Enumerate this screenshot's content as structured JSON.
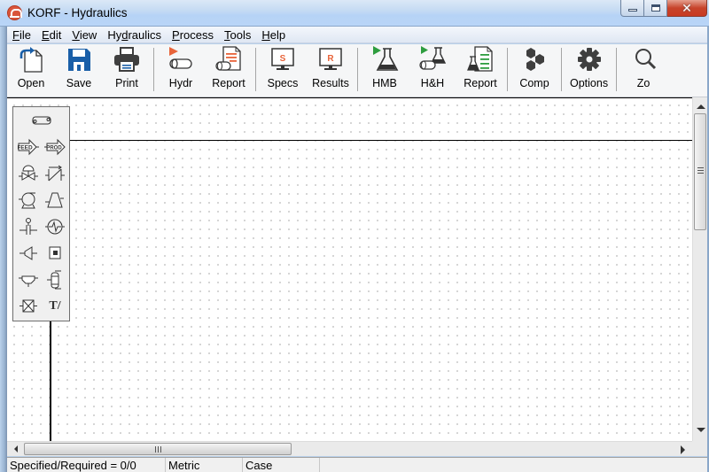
{
  "window": {
    "title": "KORF - Hydraulics",
    "controls": {
      "minimize": "minimize",
      "maximize": "maximize",
      "close": "✕"
    }
  },
  "menu": [
    {
      "label": "File",
      "mnemonic": "F"
    },
    {
      "label": "Edit",
      "mnemonic": "E"
    },
    {
      "label": "View",
      "mnemonic": "V"
    },
    {
      "label": "Hydraulics",
      "mnemonic": "d"
    },
    {
      "label": "Process",
      "mnemonic": "P"
    },
    {
      "label": "Tools",
      "mnemonic": "T"
    },
    {
      "label": "Help",
      "mnemonic": "H"
    }
  ],
  "toolbar": {
    "buttons": [
      {
        "label": "Open",
        "icon": "open-file-icon"
      },
      {
        "label": "Save",
        "icon": "save-disk-icon"
      },
      {
        "label": "Print",
        "icon": "printer-icon"
      },
      {
        "label": "Hydr",
        "icon": "run-hydraulics-icon"
      },
      {
        "label": "Report",
        "icon": "hydraulics-report-icon"
      },
      {
        "label": "Specs",
        "icon": "specs-monitor-icon",
        "glyph": "S"
      },
      {
        "label": "Results",
        "icon": "results-monitor-icon",
        "glyph": "R"
      },
      {
        "label": "HMB",
        "icon": "run-hmb-icon"
      },
      {
        "label": "H&H",
        "icon": "run-hh-icon"
      },
      {
        "label": "Report",
        "icon": "hmb-report-icon"
      },
      {
        "label": "Comp",
        "icon": "components-icon"
      },
      {
        "label": "Options",
        "icon": "gear-icon"
      },
      {
        "label": "Zo",
        "icon": "zoom-icon"
      }
    ],
    "colors": {
      "accent_orange": "#e8643a",
      "accent_green": "#2e9d3f",
      "icon_dark": "#3f3f3f",
      "save_blue": "#1a5fa8"
    }
  },
  "palette": {
    "items": [
      {
        "name": "pipe",
        "label": ""
      },
      {
        "name": "feed",
        "label": "FEED"
      },
      {
        "name": "product",
        "label": "PROD"
      },
      {
        "name": "control-valve",
        "label": ""
      },
      {
        "name": "check-valve",
        "label": ""
      },
      {
        "name": "pump",
        "label": ""
      },
      {
        "name": "compressor",
        "label": ""
      },
      {
        "name": "orifice",
        "label": ""
      },
      {
        "name": "heat-exchanger",
        "label": ""
      },
      {
        "name": "reducer",
        "label": ""
      },
      {
        "name": "misc-equipment",
        "label": ""
      },
      {
        "name": "tee",
        "label": ""
      },
      {
        "name": "vessel",
        "label": ""
      },
      {
        "name": "fitting",
        "label": ""
      },
      {
        "name": "text",
        "label": "T/"
      }
    ]
  },
  "statusbar": {
    "specified_required": "Specified/Required = 0/0",
    "units": "Metric",
    "case": "Case"
  }
}
